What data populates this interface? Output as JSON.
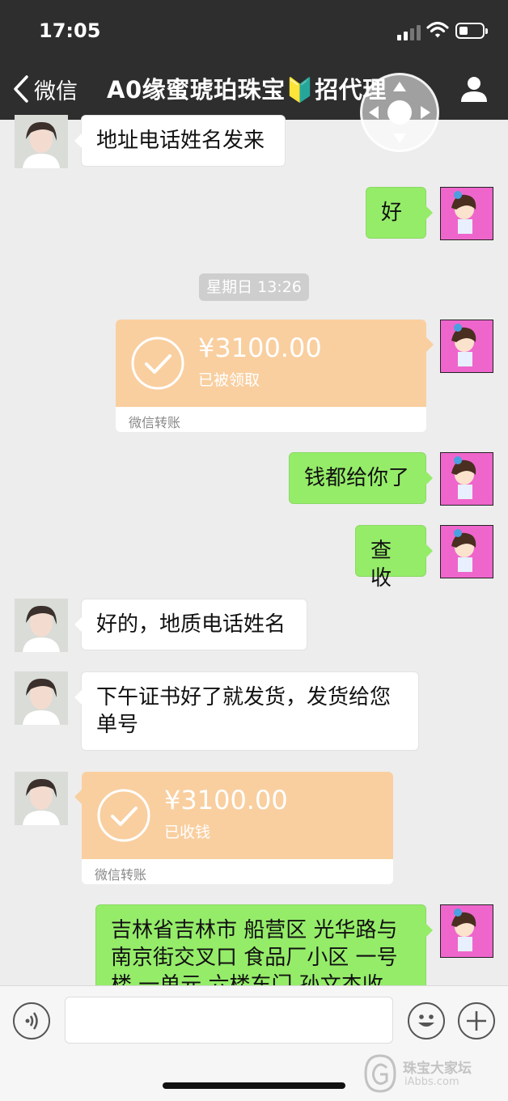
{
  "status_bar": {
    "time": "17:05"
  },
  "nav": {
    "back_label": "微信",
    "title": "A0缘蜜琥珀珠宝🔰招代理"
  },
  "messages": [
    {
      "side": "left",
      "type": "text",
      "text": "地址电话姓名发来"
    },
    {
      "side": "right",
      "type": "text",
      "text": "好"
    },
    {
      "type": "time",
      "text": "星期日 13:26"
    },
    {
      "side": "right",
      "type": "transfer",
      "amount": "¥3100.00",
      "status": "已被领取",
      "footer": "微信转账"
    },
    {
      "side": "right",
      "type": "text",
      "text": "钱都给你了"
    },
    {
      "side": "right",
      "type": "text",
      "text": "查收"
    },
    {
      "side": "left",
      "type": "text",
      "text": "好的，地质电话姓名"
    },
    {
      "side": "left",
      "type": "text",
      "text": "下午证书好了就发货，发货给您单号"
    },
    {
      "side": "left",
      "type": "transfer",
      "amount": "¥3100.00",
      "status": "已收钱",
      "footer": "微信转账"
    },
    {
      "side": "right",
      "type": "text",
      "text": "吉林省吉林市 船营区 光华路与南京街交叉口 食品厂小区 一号楼 一单元 六楼东门 孙文杰收"
    }
  ],
  "watermark": {
    "text": "珠宝大家坛",
    "sub": "iAbbs.com"
  },
  "colors": {
    "nav_bg": "#2e2e2e",
    "chat_bg": "#ededed",
    "bubble_green": "#95ec69",
    "transfer_orange": "#f9cfa0"
  }
}
